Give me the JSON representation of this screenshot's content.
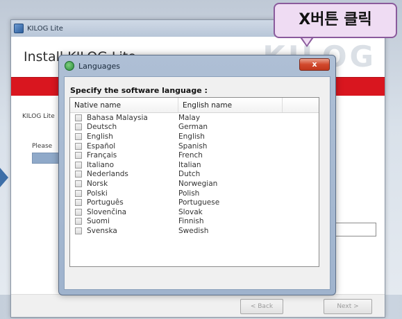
{
  "installer": {
    "title": "KILOG Lite",
    "heading": "Install KILOG Lite",
    "logo_text": "KILOG",
    "description": "KILOG Lite",
    "please_text": "Please",
    "back_button": "< Back",
    "next_button": "Next >"
  },
  "dialog": {
    "title": "Languages",
    "close_label": "x",
    "instruction": "Specify the software language :",
    "columns": {
      "native": "Native name",
      "english": "English name"
    },
    "languages": [
      {
        "native": "Bahasa Malaysia",
        "english": "Malay"
      },
      {
        "native": "Deutsch",
        "english": "German"
      },
      {
        "native": "English",
        "english": "English"
      },
      {
        "native": "Español",
        "english": "Spanish"
      },
      {
        "native": "Français",
        "english": "French"
      },
      {
        "native": "Italiano",
        "english": "Italian"
      },
      {
        "native": "Nederlands",
        "english": "Dutch"
      },
      {
        "native": "Norsk",
        "english": "Norwegian"
      },
      {
        "native": "Polski",
        "english": "Polish"
      },
      {
        "native": "Português",
        "english": "Portuguese"
      },
      {
        "native": "Slovenčina",
        "english": "Slovak"
      },
      {
        "native": "Suomi",
        "english": "Finnish"
      },
      {
        "native": "Svenska",
        "english": "Swedish"
      }
    ]
  },
  "callout": {
    "text": "X버튼 클릭"
  },
  "colors": {
    "red_band": "#d9161f",
    "callout_fill": "#efdcf3",
    "callout_border": "#8a5a9c",
    "close_button": "#d2482c"
  }
}
